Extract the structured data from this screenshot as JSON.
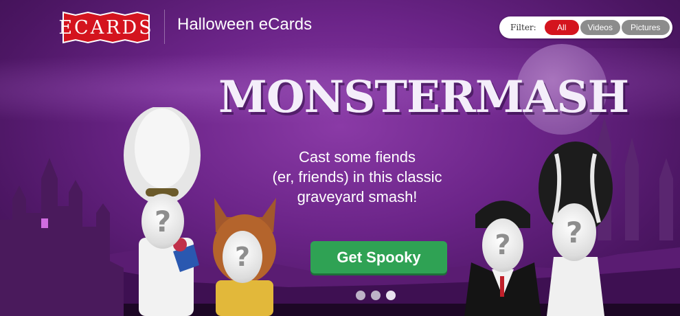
{
  "header": {
    "logo_text": "ECARDS",
    "section_title": "Halloween eCards"
  },
  "filter": {
    "label": "Filter:",
    "options": [
      "All",
      "Videos",
      "Pictures"
    ],
    "selected": "All"
  },
  "hero": {
    "title": "MONSTERMASH",
    "tagline": [
      "Cast some fiends",
      "(er, friends) in this classic",
      "graveyard smash!"
    ],
    "cta_label": "Get Spooky"
  },
  "carousel": {
    "total": 3,
    "active": 2
  },
  "icons": {
    "face_placeholder": "?"
  },
  "colors": {
    "logo_red": "#d4141e",
    "cta_green": "#2fa254",
    "background_purple": "#6b2488"
  }
}
